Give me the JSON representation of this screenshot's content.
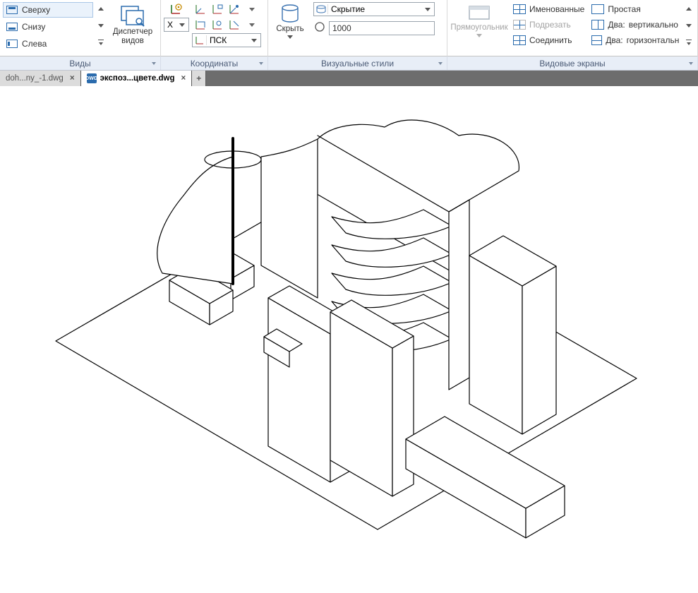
{
  "ribbon": {
    "views": {
      "items": [
        {
          "label": "Сверху",
          "selected": true
        },
        {
          "label": "Снизу",
          "selected": false
        },
        {
          "label": "Слева",
          "selected": false
        }
      ],
      "big_button": {
        "line1": "Диспетчер",
        "line2": "видов"
      }
    },
    "coords": {
      "x_dropdown_label": "X",
      "ucs_dropdown": "ПСК"
    },
    "visual_styles": {
      "hide_button": "Скрыть",
      "hide_mode_combo": "Скрытие",
      "value_field": "1000"
    },
    "viewports": {
      "rect_button": "Прямоугольник",
      "named": "Именованные",
      "trim": "Подрезать",
      "join": "Соединить",
      "layouts": {
        "simple": "Простая",
        "two_v_prefix": "Два:",
        "two_v": "вертикально",
        "two_h_prefix": "Два:",
        "two_h": "горизонтальн"
      }
    }
  },
  "panel_titles": {
    "views": "Виды",
    "coords": "Координаты",
    "visual_styles": "Визуальные стили",
    "viewports": "Видовые экраны"
  },
  "tabs": {
    "inactive": "doh...ny_-1.dwg",
    "active": "экспоз...цвете.dwg"
  }
}
